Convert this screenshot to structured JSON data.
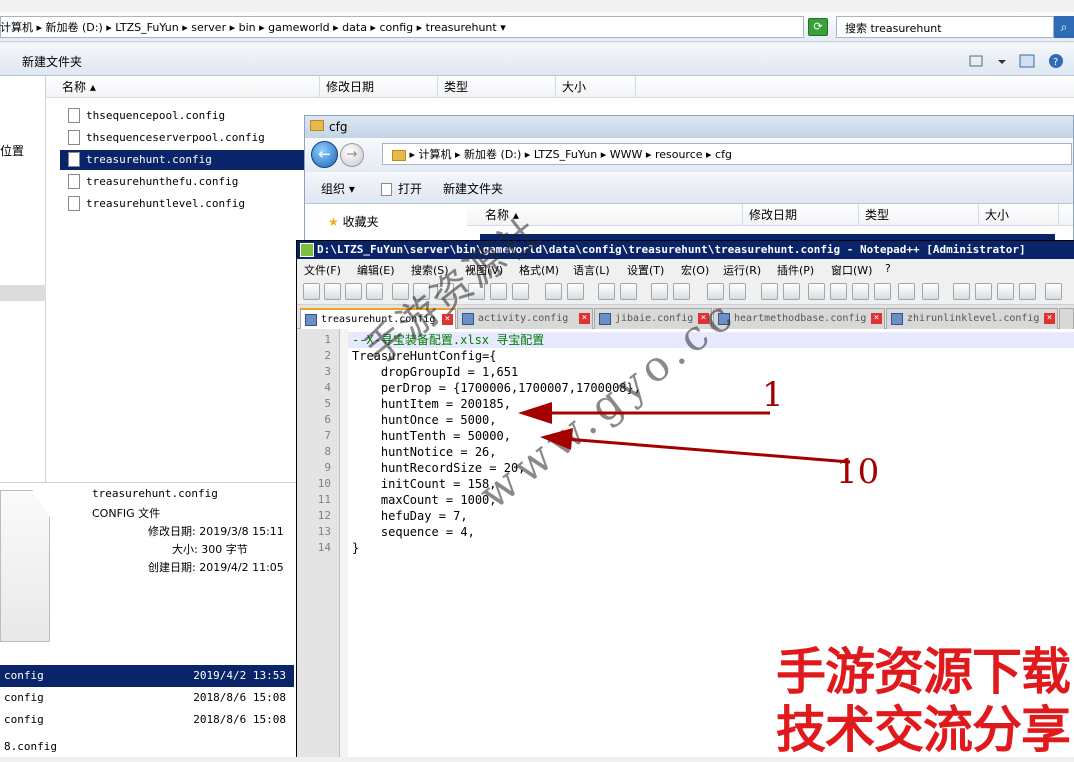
{
  "explorer_back": {
    "address_segments": [
      "计算机",
      "新加卷 (D:)",
      "LTZS_FuYun",
      "server",
      "bin",
      "gameworld",
      "data",
      "config",
      "treasurehunt"
    ],
    "search_placeholder": "搜索 treasurehunt",
    "toolbar": {
      "organize": "",
      "new_folder": "新建文件夹"
    },
    "nav": {
      "location_label": "位置"
    },
    "columns": [
      "名称",
      "修改日期",
      "类型",
      "大小"
    ],
    "files": [
      {
        "name": "thsequencepool.config",
        "selected": false
      },
      {
        "name": "thsequenceserverpool.config",
        "selected": false
      },
      {
        "name": "treasurehunt.config",
        "selected": true
      },
      {
        "name": "treasurehunthefu.config",
        "selected": false
      },
      {
        "name": "treasurehuntlevel.config",
        "selected": false
      }
    ],
    "details": {
      "filename": "treasurehunt.config",
      "filetype": "CONFIG 文件",
      "modified": "修改日期: 2019/3/8 15:11",
      "size": "大小: 300 字节",
      "created": "创建日期: 2019/4/2 11:05"
    },
    "bottom_rows": [
      {
        "name": "config",
        "date": "2019/4/2 13:53",
        "selected": true
      },
      {
        "name": "config",
        "date": "2018/8/6 15:08",
        "selected": false
      },
      {
        "name": "config",
        "date": "2018/8/6 15:08",
        "selected": false
      },
      {
        "name": "8.config",
        "date": "",
        "selected": false
      }
    ]
  },
  "explorer_cfg": {
    "title": "cfg",
    "address_segments": [
      "计算机",
      "新加卷 (D:)",
      "LTZS_FuYun",
      "WWW",
      "resource",
      "cfg"
    ],
    "toolbar": {
      "organize": "组织 ▾",
      "open": "打开",
      "new_folder": "新建文件夹"
    },
    "nav": {
      "favorites": "收藏夹"
    },
    "columns": [
      "名称",
      "修改日期",
      "类型",
      "大小"
    ]
  },
  "notepad": {
    "title": "D:\\LTZS_FuYun\\server\\bin\\gameworld\\data\\config\\treasurehunt\\treasurehunt.config - Notepad++ [Administrator]",
    "menu": [
      "文件(F)",
      "编辑(E)",
      "搜索(S)",
      "视图(V)",
      "格式(M)",
      "语言(L)",
      "设置(T)",
      "宏(O)",
      "运行(R)",
      "插件(P)",
      "窗口(W)",
      "?"
    ],
    "tabs": [
      {
        "label": "treasurehunt.config",
        "active": true
      },
      {
        "label": "activity.config",
        "active": false
      },
      {
        "label": "jibaie.config",
        "active": false
      },
      {
        "label": "heartmethodbase.config",
        "active": false
      },
      {
        "label": "zhirunlinklevel.config",
        "active": false
      }
    ],
    "code_lines": [
      "--X-寻宝装备配置.xlsx 寻宝配置",
      "TreasureHuntConfig={",
      "    dropGroupId = 1,651",
      "    perDrop = {1700006,1700007,1700008},",
      "    huntItem = 200185,",
      "    huntOnce = 5000,",
      "    huntTenth = 50000,",
      "    huntNotice = 26,",
      "    huntRecordSize = 20,",
      "    initCount = 158,",
      "    maxCount = 1000,",
      "    hefuDay = 7,",
      "    sequence = 4,",
      "}"
    ]
  },
  "annotations": {
    "arrow1_label": "1",
    "arrow2_label": "10"
  },
  "watermark": {
    "line1": "手游资源社",
    "line2": "www.gyo.cc"
  },
  "banner": {
    "line1": "手游资源下载",
    "line2": "技术交流分享"
  },
  "colors": {
    "selection": "#0a246a",
    "annotation": "#a50000",
    "banner": "#e0191c"
  }
}
